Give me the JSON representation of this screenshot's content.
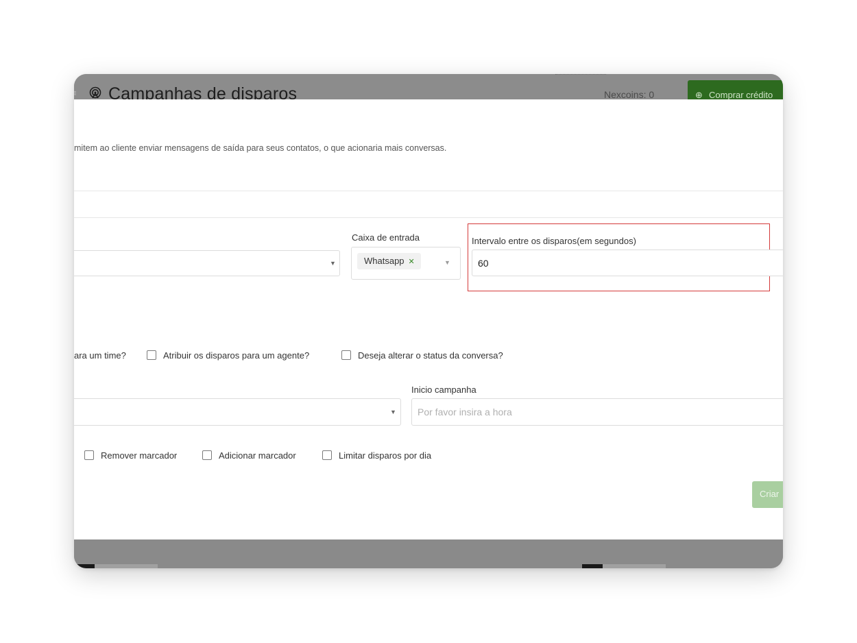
{
  "header": {
    "title": "Campanhas de disparos",
    "nexcoins": "Nexcoins: 0",
    "buy_credits": "Comprar crédito"
  },
  "modal": {
    "description": "mitem ao cliente enviar mensagens de saída para seus contatos, o que acionaria mais conversas.",
    "inbox_label": "Caixa de entrada",
    "inbox_tag": "Whatsapp",
    "interval_label": "Intervalo entre os disparos(em segundos)",
    "interval_value": "60",
    "assign_checkboxes": [
      {
        "label": "ara um time?",
        "checked": false
      },
      {
        "label": "Atribuir os disparos para um agente?",
        "checked": false
      },
      {
        "label": "Deseja alterar o status da conversa?",
        "checked": false
      }
    ],
    "start_label": "Inicio campanha",
    "start_placeholder": "Por favor insira a hora",
    "marker_checkboxes": [
      {
        "label": "Remover marcador",
        "checked": false
      },
      {
        "label": "Adicionar marcador",
        "checked": false
      },
      {
        "label": "Limitar disparos por dia",
        "checked": false
      }
    ],
    "create_button": "Criar"
  },
  "colors": {
    "overlay": "#8a8a8a",
    "brand_green": "#2d6a1f",
    "create_disabled": "#a9cfa0",
    "highlight": "#d43a3a"
  }
}
